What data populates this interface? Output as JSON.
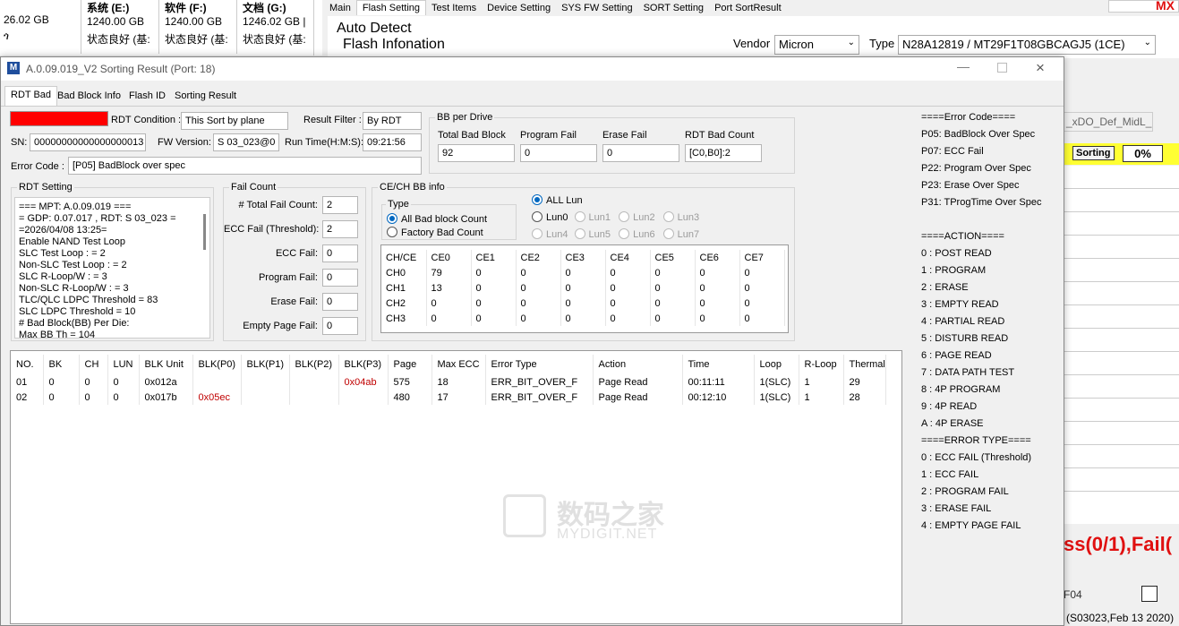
{
  "background": {
    "drives": [
      {
        "size": "26.02 GB",
        "sub": "ጎ"
      },
      {
        "name": "系统 (E:)",
        "size": "1240.00 GB",
        "status": "状态良好 (基:"
      },
      {
        "name": "软件 (F:)",
        "size": "1240.00 GB",
        "status": "状态良好 (基:"
      },
      {
        "name": "文档 (G:)",
        "size": "1246.02 GB |",
        "status": "状态良好 (基:"
      }
    ],
    "tabs": [
      "Main",
      "Flash Setting",
      "Test Items",
      "Device Setting",
      "SYS FW Setting",
      "SORT Setting",
      "Port SortResult"
    ],
    "mx_label": "MX",
    "auto_detect": "Auto Detect",
    "flash_information": "Flash Infonation",
    "vendor_label": "Vendor",
    "vendor_value": "Micron",
    "type_label": "Type",
    "type_value": "N28A12819  /  MT29F1T08GBCAGJ5 (1CE)",
    "def_label": "_xDO_Def_MidL_",
    "sorting_label": "Sorting",
    "sorting_percent": "0%",
    "pass_fail": "ss(0/1),Fail(",
    "f04": "F04",
    "footer": "(S03023,Feb 13 2020)"
  },
  "window": {
    "icon_letter": "M",
    "title": "A.0.09.019_V2 Sorting Result (Port: 18)",
    "tabs": [
      "RDT Bad",
      "Bad Block Info",
      "Flash ID",
      "Sorting Result"
    ],
    "status_color": "#ff0000",
    "rdt_condition_label": "RDT Condition :",
    "rdt_condition_value": "This Sort by plane",
    "result_filter_label": "Result Filter :",
    "result_filter_value": "By RDT",
    "sn_label": "SN:",
    "sn_value": "00000000000000000013",
    "fw_label": "FW Version:",
    "fw_value": "S 03_023@0",
    "runtime_label": "Run Time(H:M:S):",
    "runtime_value": "09:21:56",
    "error_code_label": "Error Code :",
    "error_code_value": "[P05] BadBlock over spec",
    "bb_per_drive": {
      "title": "BB per Drive",
      "fields": [
        {
          "label": "Total Bad Block",
          "value": "92"
        },
        {
          "label": "Program Fail",
          "value": "0"
        },
        {
          "label": "Erase Fail",
          "value": "0"
        },
        {
          "label": "RDT Bad Count",
          "value": "[C0,B0]:2"
        }
      ]
    },
    "rdt_setting": {
      "title": "RDT Setting",
      "lines": [
        "=== MPT: A.0.09.019 ===",
        "= GDP: 0.07.017 , RDT: S 03_023    =",
        "=2026/04/08 13:25=",
        "Enable NAND Test Loop",
        "SLC Test Loop : = 2",
        "Non-SLC Test Loop : = 2",
        "SLC R-Loop/W : = 3",
        "Non-SLC R-Loop/W : = 3",
        "TLC/QLC LDPC Threshold = 83",
        "SLC LDPC Threshold = 10",
        "# Bad Block(BB) Per Die:",
        "Max BB Th = 104"
      ]
    },
    "fail_count": {
      "title": "Fail Count",
      "fields": [
        {
          "label": "# Total Fail Count:",
          "value": "2"
        },
        {
          "label": "ECC Fail (Threshold):",
          "value": "2"
        },
        {
          "label": "ECC Fail:",
          "value": "0"
        },
        {
          "label": "Program Fail:",
          "value": "0"
        },
        {
          "label": "Erase Fail:",
          "value": "0"
        },
        {
          "label": "Empty Page Fail:",
          "value": "0"
        }
      ]
    },
    "cech": {
      "title": "CE/CH BB info",
      "type_title": "Type",
      "type_options": [
        "All Bad block Count",
        "Factory Bad Count"
      ],
      "all_lun": "ALL Lun",
      "luns": [
        "Lun0",
        "Lun1",
        "Lun2",
        "Lun3",
        "Lun4",
        "Lun5",
        "Lun6",
        "Lun7"
      ],
      "headers": [
        "CH/CE",
        "CE0",
        "CE1",
        "CE2",
        "CE3",
        "CE4",
        "CE5",
        "CE6",
        "CE7"
      ],
      "rows": [
        [
          "CH0",
          "79",
          "0",
          "0",
          "0",
          "0",
          "0",
          "0",
          "0"
        ],
        [
          "CH1",
          "13",
          "0",
          "0",
          "0",
          "0",
          "0",
          "0",
          "0"
        ],
        [
          "CH2",
          "0",
          "0",
          "0",
          "0",
          "0",
          "0",
          "0",
          "0"
        ],
        [
          "CH3",
          "0",
          "0",
          "0",
          "0",
          "0",
          "0",
          "0",
          "0"
        ]
      ]
    },
    "results": {
      "headers": [
        "NO.",
        "BK",
        "CH",
        "LUN",
        "BLK Unit",
        "BLK(P0)",
        "BLK(P1)",
        "BLK(P2)",
        "BLK(P3)",
        "Page",
        "Max ECC",
        "Error Type",
        "Action",
        "Time",
        "Loop",
        "R-Loop",
        "Thermal"
      ],
      "rows": [
        [
          "01",
          "0",
          "0",
          "0",
          "0x012a",
          "",
          "",
          "",
          "0x04ab",
          "575",
          "18",
          "ERR_BIT_OVER_F",
          "Page Read",
          "00:11:11",
          "1(SLC)",
          "1",
          "29"
        ],
        [
          "02",
          "0",
          "0",
          "0",
          "0x017b",
          "0x05ec",
          "",
          "",
          "",
          "480",
          "17",
          "ERR_BIT_OVER_F",
          "Page Read",
          "00:12:10",
          "1(SLC)",
          "1",
          "28"
        ]
      ]
    },
    "watermark": {
      "line1": "数码之家",
      "line2": "MYDIGIT.NET"
    },
    "codes": [
      "====Error Code====",
      "P05: BadBlock Over Spec",
      "P07: ECC Fail",
      "P22: Program Over Spec",
      "P23: Erase Over Spec",
      "P31: TProgTime Over Spec",
      "",
      "====ACTION====",
      "0 : POST READ",
      "1 : PROGRAM",
      "2 : ERASE",
      "3 : EMPTY READ",
      "4 : PARTIAL READ",
      "5 : DISTURB READ",
      "6 : PAGE READ",
      "7 : DATA PATH TEST",
      "8 : 4P PROGRAM",
      "9 : 4P READ",
      "A : 4P ERASE",
      "====ERROR TYPE====",
      "0 : ECC FAIL (Threshold)",
      "1 : ECC FAIL",
      "2 : PROGRAM FAIL",
      "3 : ERASE FAIL",
      "4 : EMPTY PAGE FAIL"
    ]
  }
}
